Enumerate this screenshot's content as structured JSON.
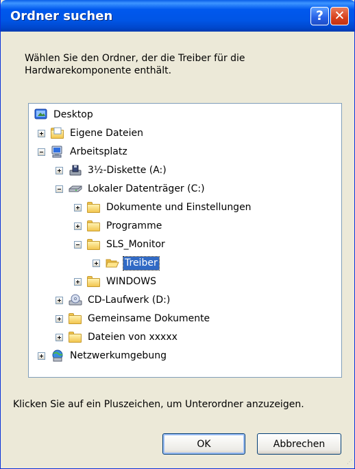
{
  "window": {
    "title": "Ordner suchen",
    "help_label": "?",
    "close_label": "✕"
  },
  "description": {
    "line1": "Wählen Sie den Ordner, der die Treiber für die",
    "line2": "Hardwarekomponente enthält."
  },
  "tree": {
    "items": [
      {
        "label": "Desktop",
        "icon": "desktop-icon",
        "expander": "none"
      },
      {
        "label": "Eigene Dateien",
        "icon": "documents-folder-icon",
        "expander": "plus"
      },
      {
        "label": "Arbeitsplatz",
        "icon": "my-computer-icon",
        "expander": "minus"
      },
      {
        "label": "3½-Diskette (A:)",
        "icon": "floppy-drive-icon",
        "expander": "plus"
      },
      {
        "label": "Lokaler Datenträger (C:)",
        "icon": "hard-drive-icon",
        "expander": "minus"
      },
      {
        "label": "Dokumente und Einstellungen",
        "icon": "folder-icon",
        "expander": "plus"
      },
      {
        "label": "Programme",
        "icon": "folder-icon",
        "expander": "plus"
      },
      {
        "label": "SLS_Monitor",
        "icon": "folder-icon",
        "expander": "minus"
      },
      {
        "label": "Treiber",
        "icon": "open-folder-icon",
        "expander": "plus",
        "selected": true
      },
      {
        "label": "WINDOWS",
        "icon": "folder-icon",
        "expander": "plus"
      },
      {
        "label": "CD-Laufwerk (D:)",
        "icon": "cd-drive-icon",
        "expander": "plus"
      },
      {
        "label": "Gemeinsame Dokumente",
        "icon": "folder-icon",
        "expander": "plus"
      },
      {
        "label": "Dateien von xxxxx",
        "icon": "folder-icon",
        "expander": "plus"
      },
      {
        "label": "Netzwerkumgebung",
        "icon": "network-icon",
        "expander": "plus"
      }
    ]
  },
  "hint": "Klicken Sie auf ein Pluszeichen, um Unterordner anzuzeigen.",
  "buttons": {
    "ok": "OK",
    "cancel": "Abbrechen"
  },
  "colors": {
    "title_bar": "#0055E5",
    "selection": "#316AC5",
    "dialog_bg": "#ECE9D8"
  }
}
